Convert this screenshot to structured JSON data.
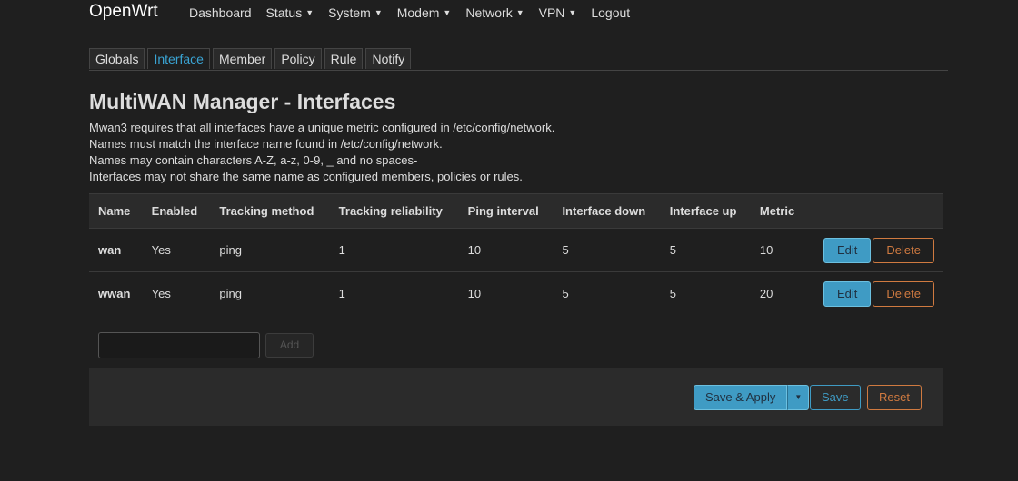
{
  "brand": "OpenWrt",
  "nav": [
    {
      "label": "Dashboard",
      "dropdown": false
    },
    {
      "label": "Status",
      "dropdown": true
    },
    {
      "label": "System",
      "dropdown": true
    },
    {
      "label": "Modem",
      "dropdown": true
    },
    {
      "label": "Network",
      "dropdown": true
    },
    {
      "label": "VPN",
      "dropdown": true
    },
    {
      "label": "Logout",
      "dropdown": false
    }
  ],
  "tabs": [
    {
      "label": "Globals",
      "active": false
    },
    {
      "label": "Interface",
      "active": true
    },
    {
      "label": "Member",
      "active": false
    },
    {
      "label": "Policy",
      "active": false
    },
    {
      "label": "Rule",
      "active": false
    },
    {
      "label": "Notify",
      "active": false
    }
  ],
  "page": {
    "title": "MultiWAN Manager - Interfaces",
    "description": [
      "Mwan3 requires that all interfaces have a unique metric configured in /etc/config/network.",
      "Names must match the interface name found in /etc/config/network.",
      "Names may contain characters A-Z, a-z, 0-9, _ and no spaces-",
      "Interfaces may not share the same name as configured members, policies or rules."
    ]
  },
  "table": {
    "headers": [
      "Name",
      "Enabled",
      "Tracking method",
      "Tracking reliability",
      "Ping interval",
      "Interface down",
      "Interface up",
      "Metric"
    ],
    "rows": [
      [
        "wan",
        "Yes",
        "ping",
        "1",
        "10",
        "5",
        "5",
        "10"
      ],
      [
        "wwan",
        "Yes",
        "ping",
        "1",
        "10",
        "5",
        "5",
        "20"
      ]
    ],
    "edit_label": "Edit",
    "delete_label": "Delete"
  },
  "add": {
    "input_value": "",
    "button_label": "Add"
  },
  "footer": {
    "save_apply_label": "Save & Apply",
    "save_label": "Save",
    "reset_label": "Reset"
  },
  "colors": {
    "background": "#1f1f1f",
    "accent": "#3f9bc4",
    "danger": "#d07a40",
    "active_tab": "#3aa4d4"
  }
}
